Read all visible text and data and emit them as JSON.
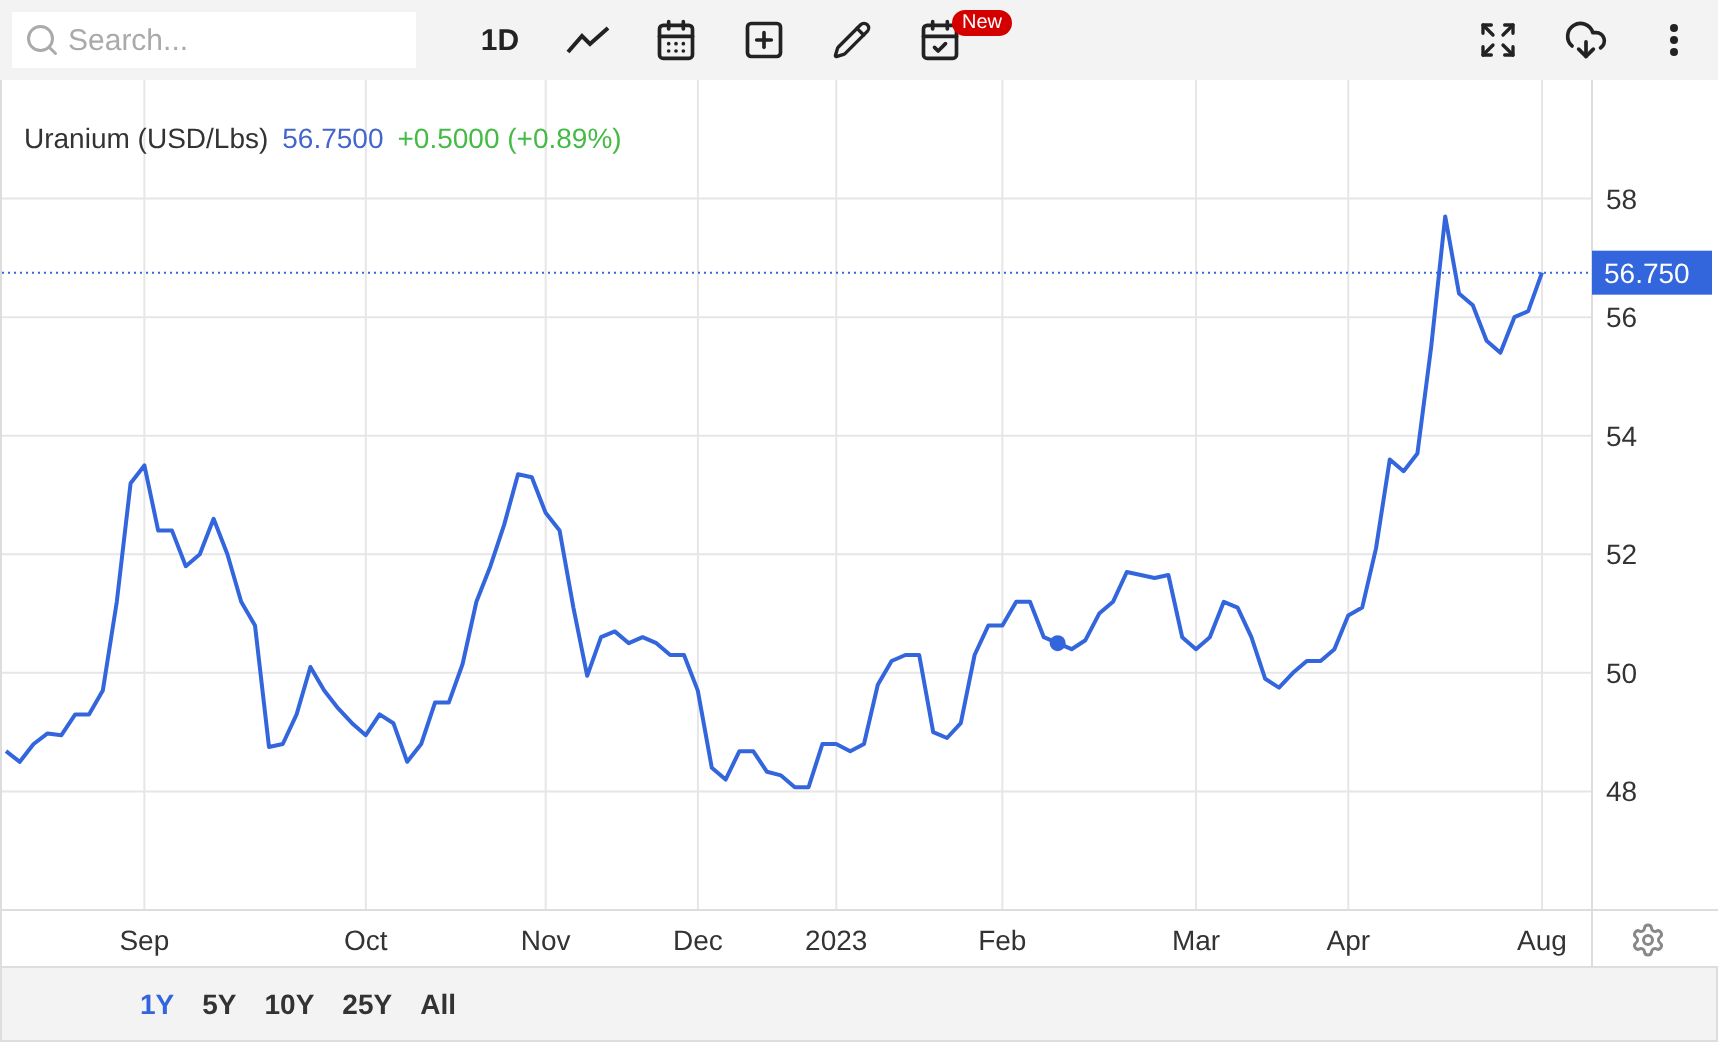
{
  "search": {
    "placeholder": "Search..."
  },
  "toolbar": {
    "interval": "1D",
    "badge": "New"
  },
  "legend": {
    "price": "56.7500",
    "change": "+0.5000 (+0.89%)"
  },
  "chart_data": {
    "ref_lines": [
      {
        "axis": "y",
        "value": 56.75,
        "label": "56.750"
      }
    ],
    "type": "line",
    "grid": true,
    "ylim": [
      46,
      60
    ],
    "yticks": [
      48,
      50,
      52,
      54,
      56,
      58
    ],
    "categories": [
      null,
      null,
      null,
      null,
      null,
      null,
      null,
      null,
      null,
      null,
      "Sep",
      null,
      null,
      null,
      null,
      null,
      null,
      null,
      null,
      null,
      null,
      null,
      null,
      null,
      null,
      null,
      "Oct",
      null,
      null,
      null,
      null,
      null,
      null,
      null,
      null,
      null,
      null,
      null,
      null,
      "Nov",
      null,
      null,
      null,
      null,
      null,
      null,
      null,
      null,
      null,
      null,
      "Dec",
      null,
      null,
      null,
      null,
      null,
      null,
      null,
      null,
      null,
      "2023",
      null,
      null,
      null,
      null,
      null,
      null,
      null,
      null,
      null,
      null,
      null,
      "Feb",
      null,
      null,
      null,
      null,
      null,
      null,
      null,
      null,
      null,
      null,
      null,
      null,
      null,
      "Mar",
      null,
      null,
      null,
      null,
      null,
      null,
      null,
      null,
      null,
      null,
      "Apr",
      null,
      null,
      null,
      null,
      null,
      null,
      null,
      null,
      null,
      null,
      null,
      null,
      null,
      "Aug"
    ],
    "series": [
      {
        "name": "Uranium (USD/Lbs)",
        "color": "#3366dd",
        "values": [
          48.68,
          48.5,
          48.8,
          48.98,
          48.95,
          49.3,
          49.3,
          49.7,
          51.2,
          53.2,
          53.5,
          52.4,
          52.4,
          51.8,
          52.0,
          52.6,
          52.0,
          51.2,
          50.8,
          48.75,
          48.8,
          49.3,
          50.1,
          49.7,
          49.4,
          49.15,
          48.95,
          49.3,
          49.15,
          48.5,
          48.8,
          49.5,
          49.5,
          50.15,
          51.2,
          51.8,
          52.5,
          53.35,
          53.3,
          52.7,
          52.4,
          51.1,
          49.95,
          50.6,
          50.7,
          50.5,
          50.6,
          50.5,
          50.3,
          50.3,
          49.7,
          48.4,
          48.2,
          48.68,
          48.68,
          48.33,
          48.27,
          48.07,
          48.07,
          48.8,
          48.8,
          48.68,
          48.8,
          49.8,
          50.2,
          50.3,
          50.3,
          49.0,
          48.9,
          49.15,
          50.3,
          50.8,
          50.8,
          51.2,
          51.2,
          50.6,
          50.5,
          50.4,
          50.55,
          51.0,
          51.2,
          51.7,
          51.65,
          51.6,
          51.65,
          50.6,
          50.4,
          50.6,
          51.2,
          51.1,
          50.6,
          49.9,
          49.75,
          50.0,
          50.2,
          50.2,
          50.4,
          50.97,
          51.1,
          52.1,
          53.6,
          53.4,
          53.7,
          55.5,
          57.7,
          56.4,
          56.2,
          55.6,
          55.4,
          56.0,
          56.1,
          56.75
        ]
      }
    ]
  },
  "ranges": [
    {
      "label": "1Y",
      "selected": true
    },
    {
      "label": "5Y",
      "selected": false
    },
    {
      "label": "10Y",
      "selected": false
    },
    {
      "label": "25Y",
      "selected": false
    },
    {
      "label": "All",
      "selected": false
    }
  ]
}
